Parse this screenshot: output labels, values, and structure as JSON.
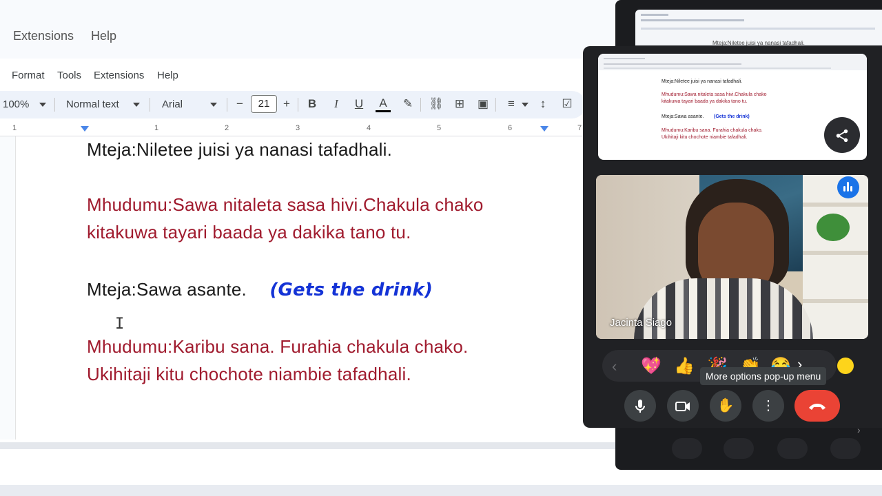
{
  "docs": {
    "menu_top": [
      "Extensions",
      "Help"
    ],
    "menu_second": [
      "Format",
      "Tools",
      "Extensions",
      "Help"
    ],
    "toolbar": {
      "zoom": "100%",
      "style": "Normal text",
      "font": "Arial",
      "font_size": "21",
      "minus": "−",
      "plus": "+"
    },
    "ruler_numbers": [
      "1",
      "1",
      "2",
      "3",
      "4",
      "5",
      "6",
      "7"
    ],
    "lines": [
      {
        "text": "Mteja:Niletee juisi ya nanasi tafadhali.",
        "color": "#1a1a1a"
      },
      {
        "text": "Mhudumu:Sawa nitaleta sasa hivi.Chakula chako",
        "color": "#a01b2e"
      },
      {
        "text": "kitakuwa tayari baada ya dakika tano tu.",
        "color": "#a01b2e"
      },
      {
        "text": "Mteja:Sawa asante.",
        "color": "#1a1a1a"
      },
      {
        "text": "Mhudumu:Karibu sana. Furahia chakula chako.",
        "color": "#a01b2e"
      },
      {
        "text": "Ukihitaji kitu chochote niambie tafadhali.",
        "color": "#a01b2e"
      }
    ],
    "note": "(Gets the drink)",
    "note_color": "#1433d6"
  },
  "meet": {
    "thumbnail_lines": [
      "Mteja:Niletee juisi ya nanasi tafadhali.",
      "Mhudumu:Sawa nitaleta sasa hivi.Chakula chako",
      "kitakuwa tayari baada ya dakika tano tu.",
      "Mteja:Sawa asante.",
      "(Gets the drink)",
      "Mhudumu:Karibu sana. Furahia chakula chako.",
      "Ukihitaji kitu chochote niambie tafadhali."
    ],
    "participant_name": "Jacinta Siago",
    "reactions": [
      "💖",
      "👍",
      "🎉",
      "👏",
      "😂"
    ],
    "tooltip": "More options pop-up menu",
    "end_call_color": "#ea4335",
    "accent": "#1a73e8"
  }
}
